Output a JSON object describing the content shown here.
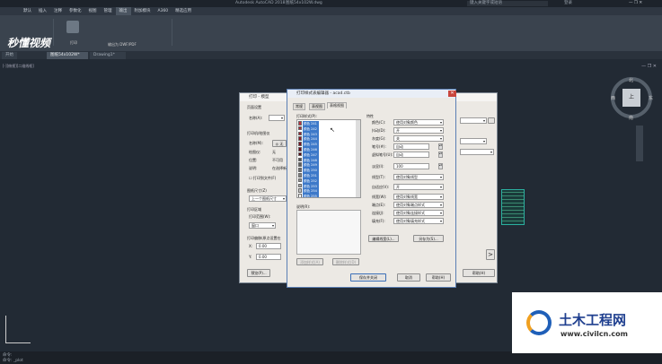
{
  "app": {
    "title": "Autodesk AutoCAD 2018",
    "file": "图纸54x102W.dwg",
    "search_hint": "键入关键字或短语",
    "user": "登录"
  },
  "menu": [
    "默认",
    "插入",
    "注释",
    "参数化",
    "视图",
    "管理",
    "输出",
    "附加模块",
    "A360",
    "精选应用"
  ],
  "ribbon": {
    "print_label": "打印",
    "export_label": "输出为 DWF/PDF"
  },
  "tabs": [
    "开始",
    "图纸54x102W*",
    "Drawing1*"
  ],
  "viewport_label": "[-][俯视][二维线框]",
  "compass": {
    "north": "北",
    "south": "南",
    "east": "东",
    "west": "西",
    "center": "上"
  },
  "plot_dialog": {
    "title": "打印 - 模型",
    "page_setup": "页面设置",
    "name_label": "名称(A):",
    "printer_section": "打印机/绘图仪",
    "name2_label": "名称(M):",
    "plotter_label": "绘图仪:",
    "plotter_value": "无",
    "location_label": "位置:",
    "location_value": "不可用",
    "desc_label": "说明:",
    "desc_value": "在选择新",
    "print_to_file": "打印到文件(F)",
    "paper_size": "图纸尺寸(Z)",
    "paper_value": "上一个图纸尺寸",
    "area_section": "打印区域",
    "area_label": "打印范围(W):",
    "area_value": "窗口",
    "offset_section": "打印偏移(原点设置在",
    "x_value": "0.00",
    "y_value": "0.00",
    "preview_btn": "预览(P)..."
  },
  "editor": {
    "title": "打印样式表编辑器 - acad.ctb",
    "tabs": [
      "常规",
      "表视图",
      "表格视图"
    ],
    "styles_label": "打印样式(P):",
    "styles": [
      "颜色 241",
      "颜色 242",
      "颜色 243",
      "颜色 244",
      "颜色 245",
      "颜色 246",
      "颜色 247",
      "颜色 248",
      "颜色 249",
      "颜色 250",
      "颜色 251",
      "颜色 252",
      "颜色 253",
      "颜色 254",
      "颜色 255"
    ],
    "swatches": [
      "#c03040",
      "#b02838",
      "#a02030",
      "#901828",
      "#801020",
      "#700818",
      "#600010",
      "#505050",
      "#606060",
      "#707070",
      "#808080",
      "#909090",
      "#a8a8a8",
      "#c0c0c0",
      "#ffffff"
    ],
    "desc_label": "说明(R):",
    "add_btn": "添加样式(A)",
    "delete_btn": "删除样式(D)",
    "props_title": "特性",
    "props": [
      {
        "label": "颜色(C):",
        "value": "使用对象颜色",
        "type": "select"
      },
      {
        "label": "抖动(D):",
        "value": "开",
        "type": "select"
      },
      {
        "label": "灰度(G):",
        "value": "关",
        "type": "select"
      },
      {
        "label": "笔号(#):",
        "value": "自动",
        "type": "spin"
      },
      {
        "label": "虚拟笔号(U):",
        "value": "自动",
        "type": "spin"
      },
      {
        "label": "淡显(I):",
        "value": "100",
        "type": "spin"
      },
      {
        "label": "线型(T):",
        "value": "使用对象线型",
        "type": "select"
      },
      {
        "label": "自适应(V):",
        "value": "开",
        "type": "select"
      },
      {
        "label": "线宽(W):",
        "value": "使用对象线宽",
        "type": "select"
      },
      {
        "label": "端点(E):",
        "value": "使用对象端点样式",
        "type": "select"
      },
      {
        "label": "连接(J):",
        "value": "使用对象连接样式",
        "type": "select"
      },
      {
        "label": "填充(F):",
        "value": "使用对象填充样式",
        "type": "select"
      }
    ],
    "edit_lw_btn": "编辑线宽(L)...",
    "saveas_btn": "另存为(S)...",
    "save_close_btn": "保存并关闭",
    "cancel_btn": "取消",
    "help_btn": "帮助(H)"
  },
  "cmd": {
    "prefix": "命令:",
    "text": "命令: _plot"
  },
  "watermark": {
    "brand": "土木工程网",
    "url": "www.civilcn.com"
  },
  "video_logo": "秒懂视频"
}
